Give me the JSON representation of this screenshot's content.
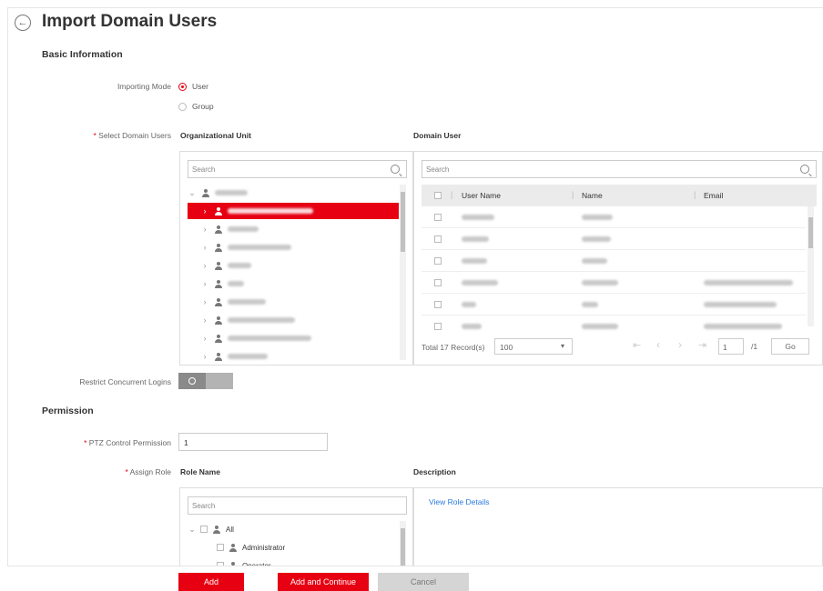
{
  "page": {
    "title": "Import Domain Users"
  },
  "basic_info": {
    "heading": "Basic Information"
  },
  "importing_mode": {
    "label": "Importing Mode",
    "options": [
      {
        "label": "User",
        "selected": true
      },
      {
        "label": "Group",
        "selected": false
      }
    ]
  },
  "select_domain_users": {
    "label": "Select Domain Users",
    "org_unit_heading": "Organizational Unit",
    "domain_user_heading": "Domain User",
    "org_search_placeholder": "Search",
    "user_search_placeholder": "Search"
  },
  "user_table": {
    "columns": [
      "User Name",
      "Name",
      "Email"
    ],
    "rows": [
      {
        "username": "",
        "name": "",
        "email": ""
      },
      {
        "username": "",
        "name": "",
        "email": ""
      },
      {
        "username": "",
        "name": "",
        "email": ""
      },
      {
        "username": "",
        "name": "",
        "email": ""
      },
      {
        "username": "",
        "name": "",
        "email": ""
      }
    ]
  },
  "pager": {
    "total": "Total 17 Record(s)",
    "page_size": "100",
    "page_number": "1",
    "page_count": "/1",
    "go": "Go"
  },
  "restrict_logins": {
    "label": "Restrict Concurrent Logins",
    "enabled": false
  },
  "permission": {
    "heading": "Permission"
  },
  "ptz": {
    "label": "PTZ Control Permission",
    "value": "1"
  },
  "assign_role": {
    "label": "Assign Role",
    "role_name_heading": "Role Name",
    "description_heading": "Description",
    "search_placeholder": "Search",
    "view_details": "View Role Details",
    "tree": [
      {
        "label": "All"
      },
      {
        "label": "Administrator"
      },
      {
        "label": "Operator"
      }
    ]
  },
  "footer": {
    "add": "Add",
    "add_continue": "Add and Continue",
    "cancel": "Cancel"
  },
  "colors": {
    "accent": "#e60012",
    "link": "#2a7ae2"
  }
}
